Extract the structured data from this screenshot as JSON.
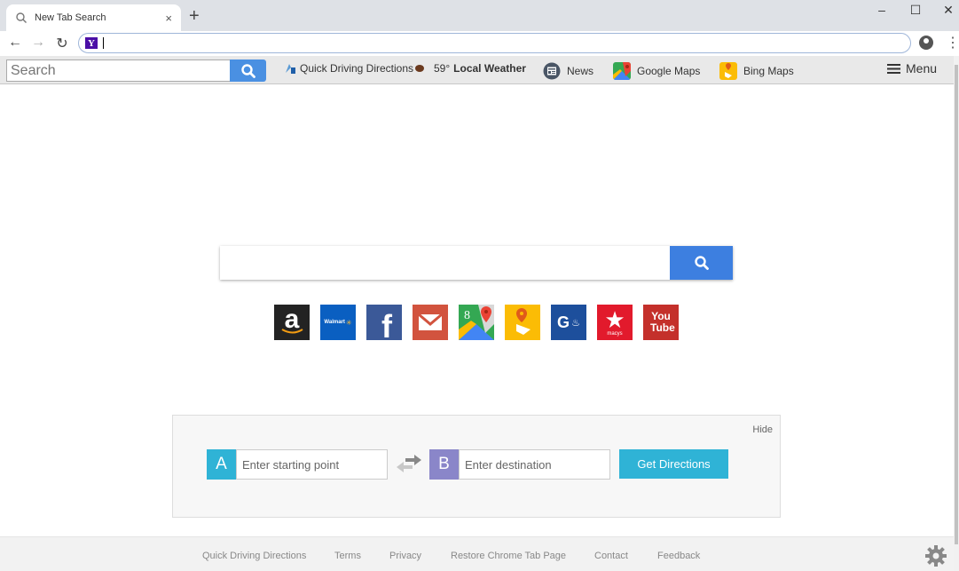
{
  "browser": {
    "tab_title": "New Tab Search",
    "tab_close": "×",
    "new_tab": "+",
    "window_controls": {
      "minimize": "–",
      "maximize": "☐",
      "close": "✕"
    },
    "nav": {
      "back": "←",
      "forward": "→",
      "reload": "↻"
    },
    "omnibox_value": "",
    "omnibox_engine_icon": "Y",
    "menu_icon": "⋮"
  },
  "toolbar": {
    "search_placeholder": "Search",
    "links": [
      {
        "label": "Quick Driving Directions",
        "icon": "directions-icon"
      },
      {
        "temp": "59°",
        "label": "Local Weather",
        "icon": "weather-icon"
      },
      {
        "label": "News",
        "icon": "news-icon"
      },
      {
        "label": "Google Maps",
        "icon": "google-maps-icon"
      },
      {
        "label": "Bing Maps",
        "icon": "bing-maps-icon"
      }
    ],
    "menu_label": "Menu"
  },
  "main_search": {
    "value": "",
    "placeholder": ""
  },
  "tiles": [
    {
      "name": "amazon",
      "label": "a",
      "bg": "#232323"
    },
    {
      "name": "walmart",
      "label": "Walmart",
      "bg": "#0a5fc1"
    },
    {
      "name": "facebook",
      "label": "f",
      "bg": "#3b5998"
    },
    {
      "name": "gmail",
      "label": "",
      "bg": "#d2533e"
    },
    {
      "name": "google-maps",
      "label": "8",
      "bg": "#34a853"
    },
    {
      "name": "bing-maps",
      "label": "",
      "bg": "#fbbc05"
    },
    {
      "name": "gasbuddy",
      "label": "G",
      "bg": "#1d4f9c"
    },
    {
      "name": "macys",
      "label": "macys",
      "bg": "#e21a2c"
    },
    {
      "name": "youtube",
      "label": "You Tube",
      "bg": "#c4302b"
    }
  ],
  "directions": {
    "hide_label": "Hide",
    "start_badge": "A",
    "start_placeholder": "Enter starting point",
    "dest_badge": "B",
    "dest_placeholder": "Enter destination",
    "button_label": "Get Directions",
    "colors": {
      "a_badge": "#2fb3d6",
      "b_badge": "#8a86c9",
      "button": "#2fb3d6"
    }
  },
  "footer": {
    "links": [
      "Quick Driving Directions",
      "Terms",
      "Privacy",
      "Restore Chrome Tab Page",
      "Contact",
      "Feedback"
    ]
  }
}
